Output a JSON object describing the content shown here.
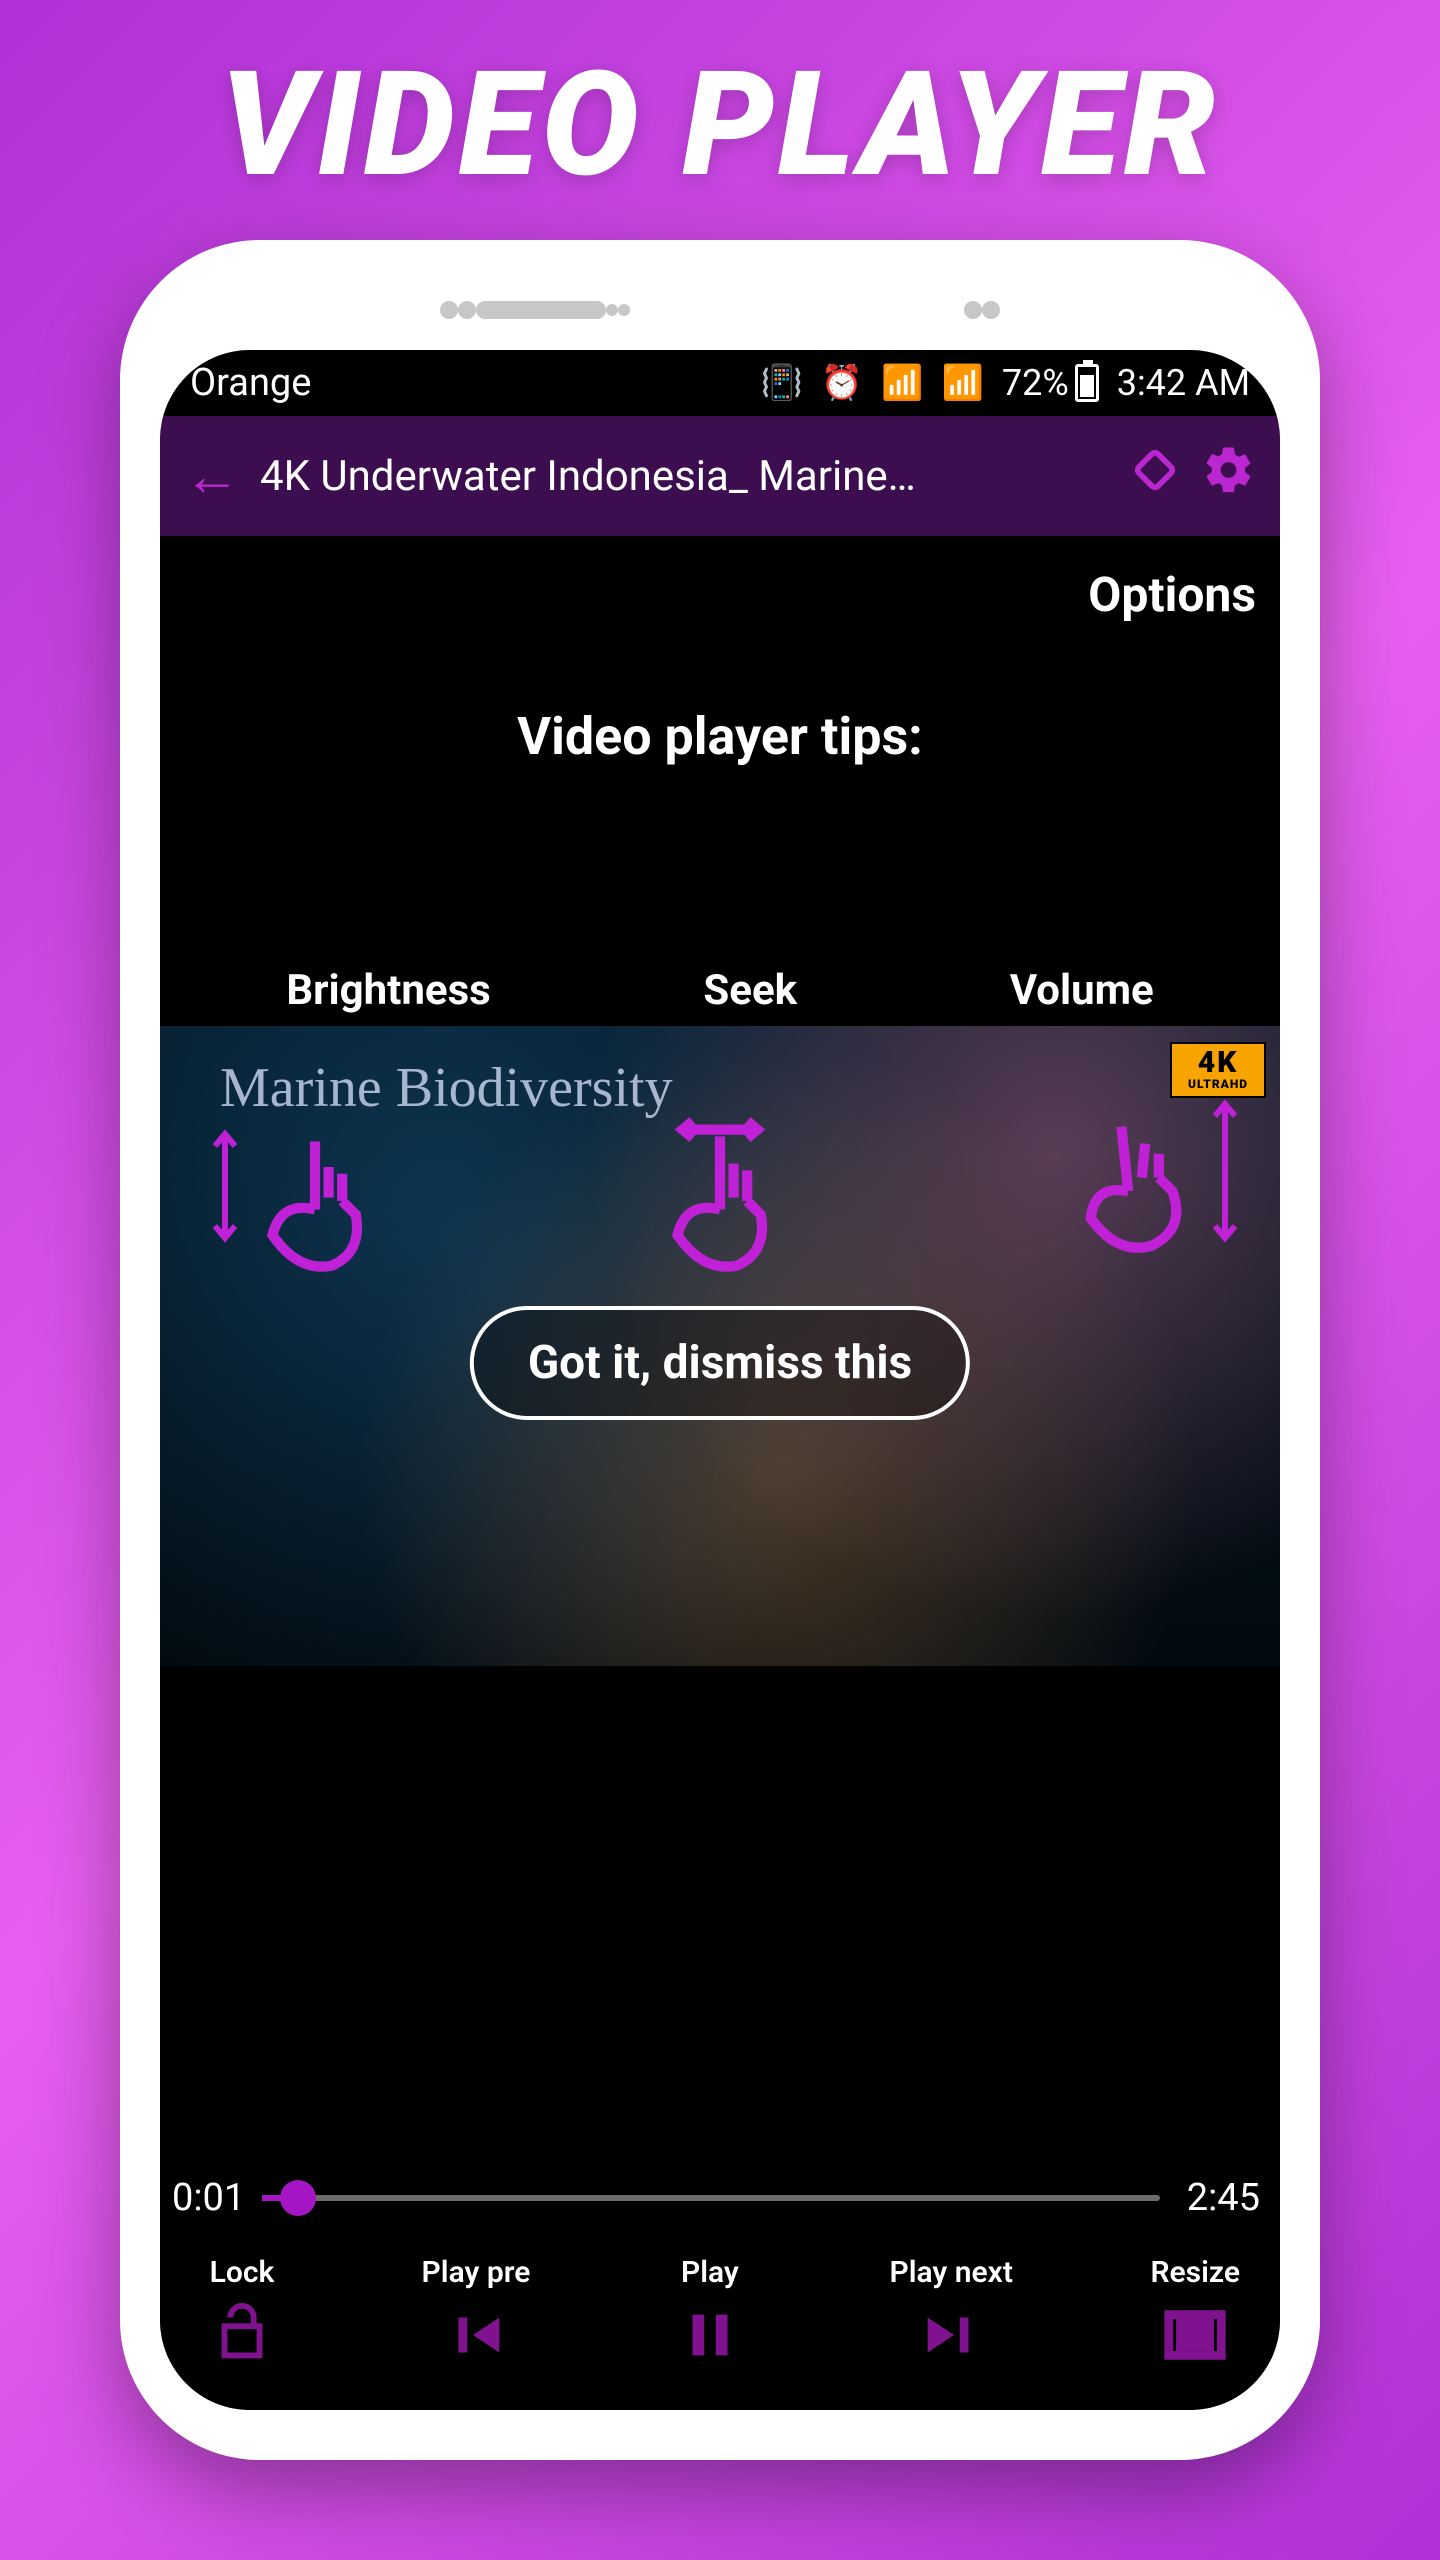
{
  "promo": {
    "title": "VIDEO PLAYER"
  },
  "status": {
    "carrier": "Orange",
    "battery_pct": "72%",
    "time": "3:42 AM"
  },
  "appbar": {
    "video_title": "4K Underwater Indonesia_ Marine…"
  },
  "content": {
    "options_label": "Options",
    "tips_title": "Video player tips:",
    "gestures": {
      "brightness": "Brightness",
      "seek": "Seek",
      "volume": "Volume"
    },
    "overlay_caption": "Marine Biodiversity",
    "badge4k": {
      "big": "4K",
      "small": "ULTRAHD"
    },
    "dismiss_label": "Got it, dismiss this"
  },
  "player": {
    "current_time": "0:01",
    "duration": "2:45",
    "controls": {
      "lock": "Lock",
      "prev": "Play pre",
      "play": "Play",
      "next": "Play next",
      "resize": "Resize"
    }
  }
}
